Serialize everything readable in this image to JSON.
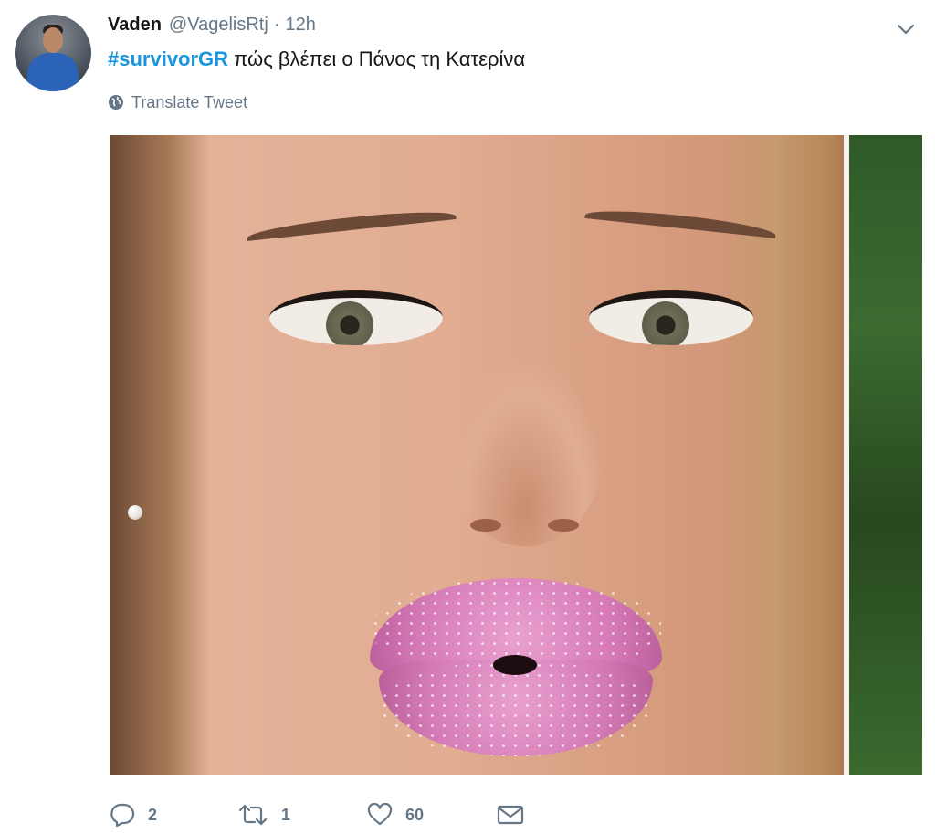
{
  "tweet": {
    "author": {
      "display_name": "Vaden",
      "handle": "@VagelisRtj",
      "separator": "·",
      "timestamp": "12h"
    },
    "hashtag": "#survivorGR",
    "body_text": " πώς βλέπει ο Πάνος τη Κατερίνα",
    "translate_label": "Translate Tweet",
    "actions": {
      "reply_count": "2",
      "retweet_count": "1",
      "like_count": "60"
    }
  },
  "icons": {
    "menu": "chevron-down-icon",
    "translate": "globe-icon",
    "reply": "reply-icon",
    "retweet": "retweet-icon",
    "like": "heart-icon",
    "message": "envelope-icon"
  },
  "colors": {
    "hashtag": "#1b95e0",
    "secondary_text": "#657786",
    "primary_text": "#14171a"
  }
}
